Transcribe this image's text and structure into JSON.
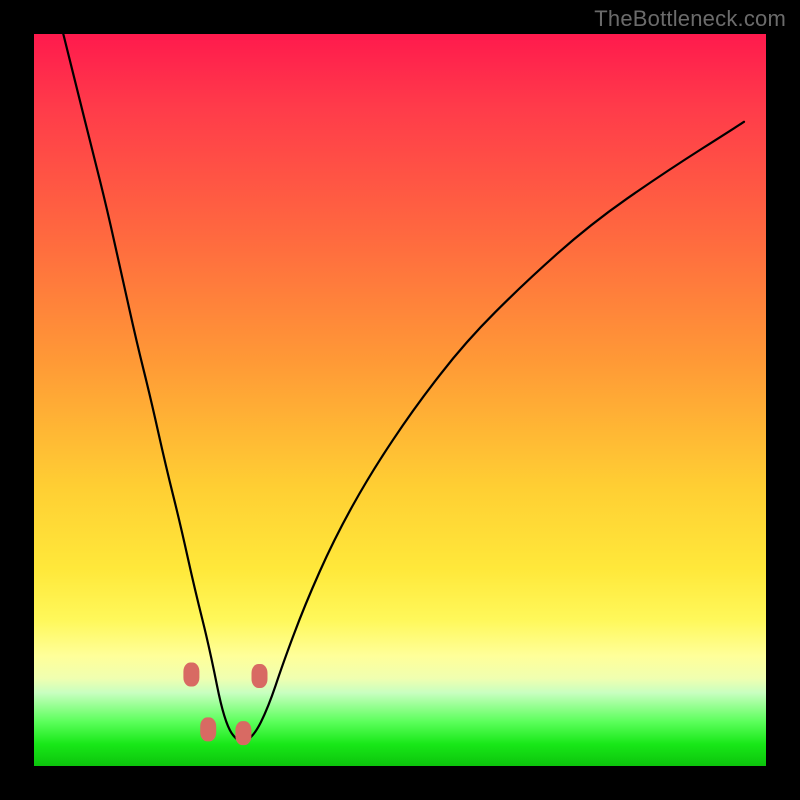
{
  "watermark": "TheBottleneck.com",
  "colors": {
    "frame": "#000000",
    "gradient_top": "#ff1a4d",
    "gradient_mid1": "#ff9a36",
    "gradient_mid2": "#ffe83a",
    "gradient_bottom": "#0cc40c",
    "curve": "#000000",
    "bead": "#d86a63"
  },
  "chart_data": {
    "type": "line",
    "title": "",
    "xlabel": "",
    "ylabel": "",
    "xlim": [
      0,
      100
    ],
    "ylim": [
      0,
      100
    ],
    "grid": false,
    "note": "Values estimated from pixels; axes unlabeled. Curve resembles a bottleneck/V-shape with minimum near x≈26, y≈3. Left branch near-vertical; right branch rises with decreasing slope.",
    "series": [
      {
        "name": "curve",
        "x": [
          4,
          6,
          8,
          10,
          12,
          14,
          16,
          18,
          20,
          22,
          24,
          26,
          28,
          30,
          32,
          34,
          37,
          41,
          46,
          52,
          59,
          67,
          76,
          86,
          97
        ],
        "y": [
          100,
          92,
          84,
          76,
          67,
          58,
          50,
          41,
          33,
          24,
          16,
          6,
          3,
          4,
          8,
          14,
          22,
          31,
          40,
          49,
          58,
          66,
          74,
          81,
          88
        ]
      }
    ],
    "annotations": {
      "beads": [
        {
          "x": 21.5,
          "y": 12.5
        },
        {
          "x": 23.8,
          "y": 5.0
        },
        {
          "x": 28.6,
          "y": 4.5
        },
        {
          "x": 30.8,
          "y": 12.3
        }
      ]
    }
  }
}
